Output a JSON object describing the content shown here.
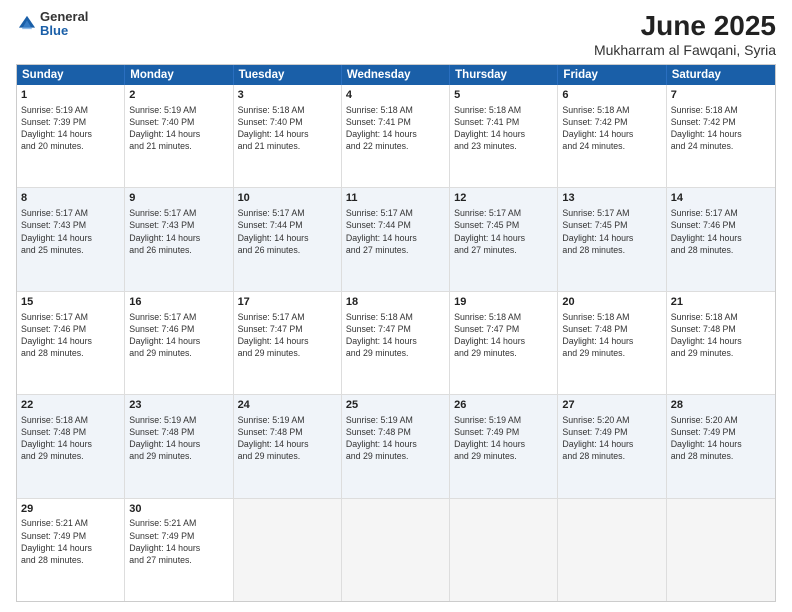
{
  "header": {
    "logo_general": "General",
    "logo_blue": "Blue",
    "title": "June 2025",
    "subtitle": "Mukharram al Fawqani, Syria"
  },
  "days": [
    "Sunday",
    "Monday",
    "Tuesday",
    "Wednesday",
    "Thursday",
    "Friday",
    "Saturday"
  ],
  "rows": [
    [
      {
        "num": "1",
        "info": "Sunrise: 5:19 AM\nSunset: 7:39 PM\nDaylight: 14 hours\nand 20 minutes."
      },
      {
        "num": "2",
        "info": "Sunrise: 5:19 AM\nSunset: 7:40 PM\nDaylight: 14 hours\nand 21 minutes."
      },
      {
        "num": "3",
        "info": "Sunrise: 5:18 AM\nSunset: 7:40 PM\nDaylight: 14 hours\nand 21 minutes."
      },
      {
        "num": "4",
        "info": "Sunrise: 5:18 AM\nSunset: 7:41 PM\nDaylight: 14 hours\nand 22 minutes."
      },
      {
        "num": "5",
        "info": "Sunrise: 5:18 AM\nSunset: 7:41 PM\nDaylight: 14 hours\nand 23 minutes."
      },
      {
        "num": "6",
        "info": "Sunrise: 5:18 AM\nSunset: 7:42 PM\nDaylight: 14 hours\nand 24 minutes."
      },
      {
        "num": "7",
        "info": "Sunrise: 5:18 AM\nSunset: 7:42 PM\nDaylight: 14 hours\nand 24 minutes."
      }
    ],
    [
      {
        "num": "8",
        "info": "Sunrise: 5:17 AM\nSunset: 7:43 PM\nDaylight: 14 hours\nand 25 minutes."
      },
      {
        "num": "9",
        "info": "Sunrise: 5:17 AM\nSunset: 7:43 PM\nDaylight: 14 hours\nand 26 minutes."
      },
      {
        "num": "10",
        "info": "Sunrise: 5:17 AM\nSunset: 7:44 PM\nDaylight: 14 hours\nand 26 minutes."
      },
      {
        "num": "11",
        "info": "Sunrise: 5:17 AM\nSunset: 7:44 PM\nDaylight: 14 hours\nand 27 minutes."
      },
      {
        "num": "12",
        "info": "Sunrise: 5:17 AM\nSunset: 7:45 PM\nDaylight: 14 hours\nand 27 minutes."
      },
      {
        "num": "13",
        "info": "Sunrise: 5:17 AM\nSunset: 7:45 PM\nDaylight: 14 hours\nand 28 minutes."
      },
      {
        "num": "14",
        "info": "Sunrise: 5:17 AM\nSunset: 7:46 PM\nDaylight: 14 hours\nand 28 minutes."
      }
    ],
    [
      {
        "num": "15",
        "info": "Sunrise: 5:17 AM\nSunset: 7:46 PM\nDaylight: 14 hours\nand 28 minutes."
      },
      {
        "num": "16",
        "info": "Sunrise: 5:17 AM\nSunset: 7:46 PM\nDaylight: 14 hours\nand 29 minutes."
      },
      {
        "num": "17",
        "info": "Sunrise: 5:17 AM\nSunset: 7:47 PM\nDaylight: 14 hours\nand 29 minutes."
      },
      {
        "num": "18",
        "info": "Sunrise: 5:18 AM\nSunset: 7:47 PM\nDaylight: 14 hours\nand 29 minutes."
      },
      {
        "num": "19",
        "info": "Sunrise: 5:18 AM\nSunset: 7:47 PM\nDaylight: 14 hours\nand 29 minutes."
      },
      {
        "num": "20",
        "info": "Sunrise: 5:18 AM\nSunset: 7:48 PM\nDaylight: 14 hours\nand 29 minutes."
      },
      {
        "num": "21",
        "info": "Sunrise: 5:18 AM\nSunset: 7:48 PM\nDaylight: 14 hours\nand 29 minutes."
      }
    ],
    [
      {
        "num": "22",
        "info": "Sunrise: 5:18 AM\nSunset: 7:48 PM\nDaylight: 14 hours\nand 29 minutes."
      },
      {
        "num": "23",
        "info": "Sunrise: 5:19 AM\nSunset: 7:48 PM\nDaylight: 14 hours\nand 29 minutes."
      },
      {
        "num": "24",
        "info": "Sunrise: 5:19 AM\nSunset: 7:48 PM\nDaylight: 14 hours\nand 29 minutes."
      },
      {
        "num": "25",
        "info": "Sunrise: 5:19 AM\nSunset: 7:48 PM\nDaylight: 14 hours\nand 29 minutes."
      },
      {
        "num": "26",
        "info": "Sunrise: 5:19 AM\nSunset: 7:49 PM\nDaylight: 14 hours\nand 29 minutes."
      },
      {
        "num": "27",
        "info": "Sunrise: 5:20 AM\nSunset: 7:49 PM\nDaylight: 14 hours\nand 28 minutes."
      },
      {
        "num": "28",
        "info": "Sunrise: 5:20 AM\nSunset: 7:49 PM\nDaylight: 14 hours\nand 28 minutes."
      }
    ],
    [
      {
        "num": "29",
        "info": "Sunrise: 5:21 AM\nSunset: 7:49 PM\nDaylight: 14 hours\nand 28 minutes."
      },
      {
        "num": "30",
        "info": "Sunrise: 5:21 AM\nSunset: 7:49 PM\nDaylight: 14 hours\nand 27 minutes."
      },
      {
        "num": "",
        "info": ""
      },
      {
        "num": "",
        "info": ""
      },
      {
        "num": "",
        "info": ""
      },
      {
        "num": "",
        "info": ""
      },
      {
        "num": "",
        "info": ""
      }
    ]
  ]
}
